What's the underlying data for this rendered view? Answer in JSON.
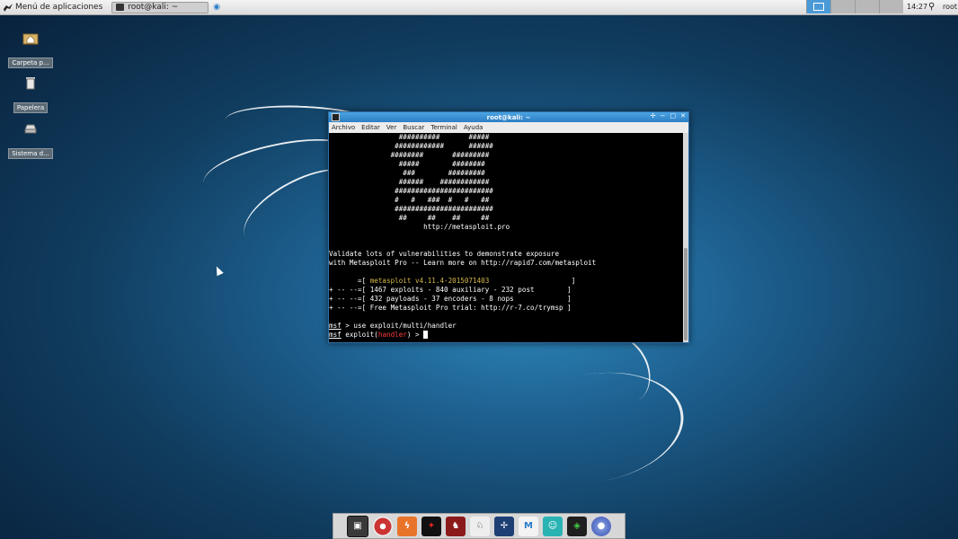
{
  "top_panel": {
    "app_menu_label": "Menú de aplicaciones",
    "task_label": "root@kali: ~",
    "clock": "14:27",
    "user": "root"
  },
  "desktop_icons": [
    {
      "label": "Carpeta p...",
      "icon": "home-folder-icon"
    },
    {
      "label": "Papelera",
      "icon": "trash-icon"
    },
    {
      "label": "Sistema d...",
      "icon": "drive-icon"
    }
  ],
  "terminal": {
    "title": "root@kali: ~",
    "menu": [
      "Archivo",
      "Editar",
      "Ver",
      "Buscar",
      "Terminal",
      "Ayuda"
    ],
    "art": [
      "                 ##########       #####",
      "                ############      ######",
      "               ########       #########",
      "                 #####        ########",
      "                  ###        #########",
      "                 ######    ############",
      "                ########################",
      "                #   #   ###  #   #   ##",
      "                ########################",
      "                 ##     ##    ##     ##",
      "                       http://metasploit.pro"
    ],
    "info": [
      "Validate lots of vulnerabilities to demonstrate exposure",
      "with Metasploit Pro -- Learn more on http://rapid7.com/metasploit"
    ],
    "banner": {
      "l1_pre": "       =[ ",
      "l1_version": "metasploit v4.11.4-2015071403",
      "l1_post": "                    ]",
      "l2": "+ -- --=[ 1467 exploits - 840 auxiliary - 232 post        ]",
      "l3": "+ -- --=[ 432 payloads - 37 encoders - 8 nops             ]",
      "l4": "+ -- --=[ Free Metasploit Pro trial: http://r-7.co/trymsp ]"
    },
    "prompt1": {
      "msf": "msf",
      "rest": " > use exploit/multi/handler"
    },
    "prompt2": {
      "msf": "msf",
      "pre": " exploit(",
      "module": "handler",
      "post": ") > "
    }
  },
  "dock": [
    "terminal-app-icon",
    "armitage-icon",
    "burpsuite-icon",
    "beef-icon",
    "faraday-icon",
    "john-icon",
    "maltego-icon",
    "metasploit-icon",
    "zenmap-icon",
    "wireshark-icon",
    "firefox-icon"
  ]
}
